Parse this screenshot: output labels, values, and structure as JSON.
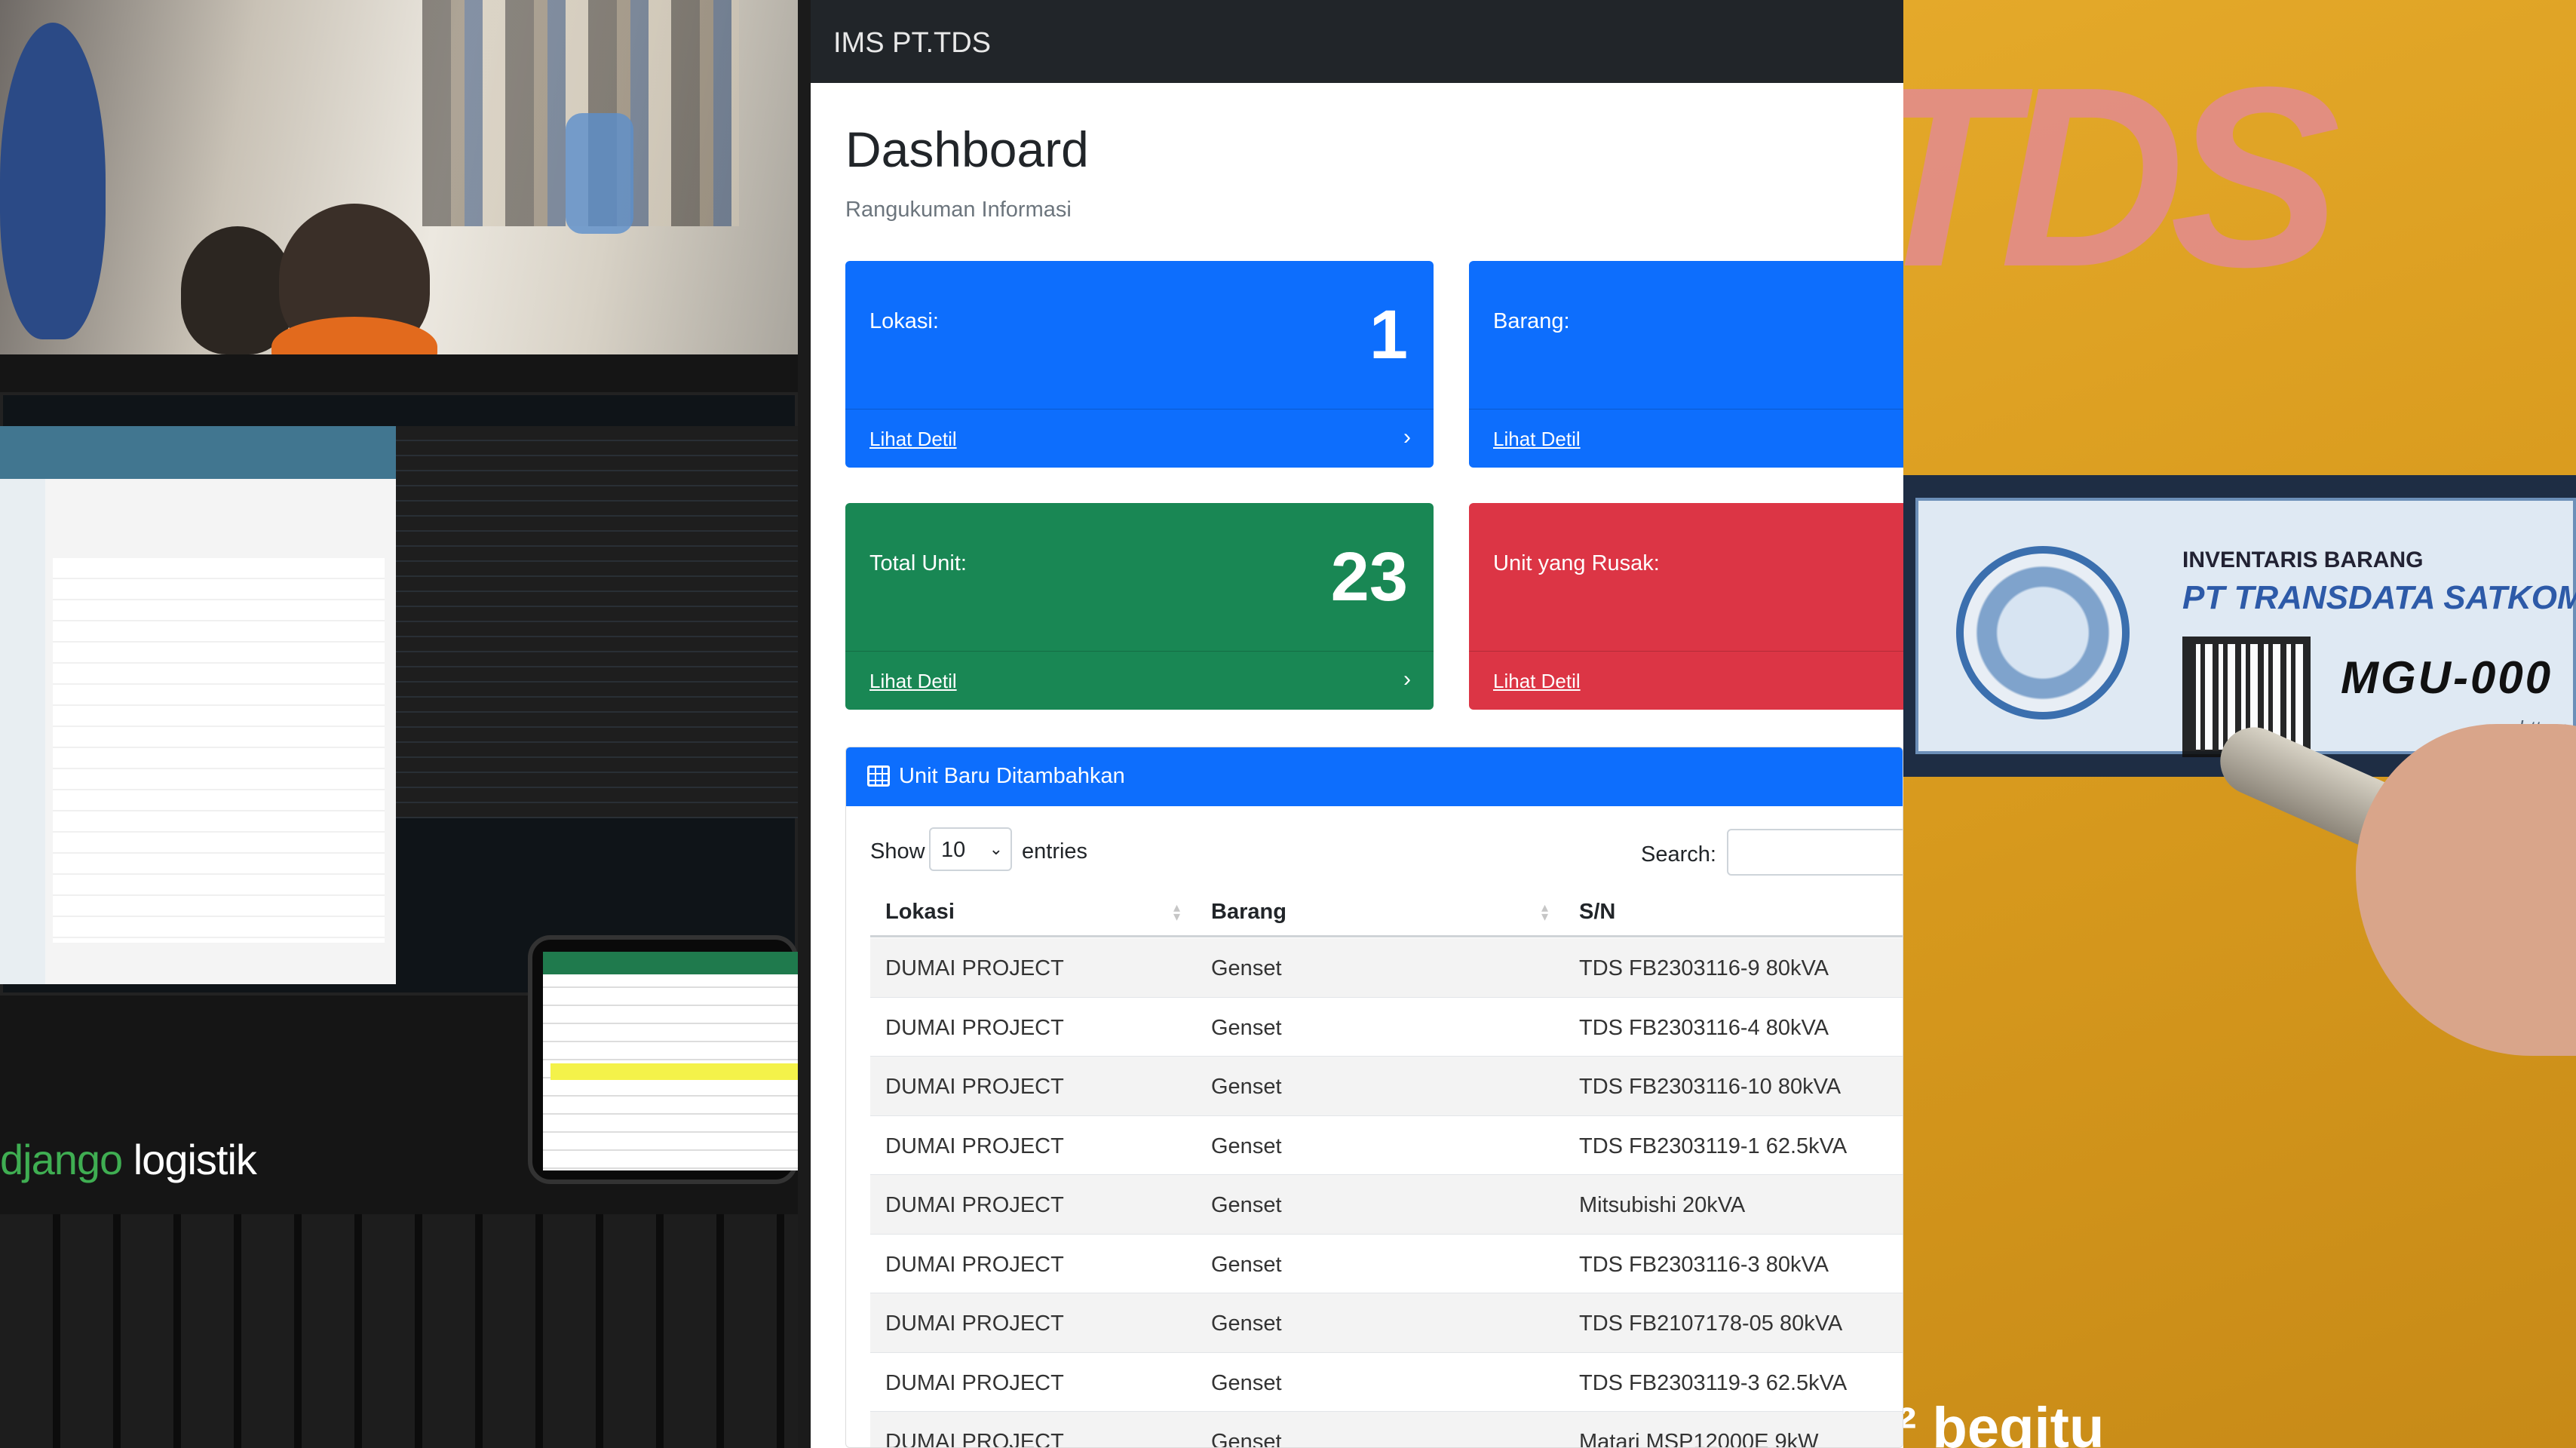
{
  "laptop_caption": {
    "part1": "django",
    "part2": "logistik"
  },
  "dashboard": {
    "brand": "IMS PT.TDS",
    "title": "Dashboard",
    "subtitle": "Rangukuman Informasi",
    "cards": {
      "lokasi": {
        "label": "Lokasi:",
        "value": "1",
        "link": "Lihat Detil"
      },
      "barang": {
        "label": "Barang:",
        "value": "",
        "link": "Lihat Detil"
      },
      "total_unit": {
        "label": "Total Unit:",
        "value": "23",
        "link": "Lihat Detil"
      },
      "unit_rusak": {
        "label": "Unit yang Rusak:",
        "value": "",
        "link": "Lihat Detil"
      }
    },
    "table": {
      "heading": "Unit Baru Ditambahkan",
      "show_label": "Show",
      "page_size": "10",
      "entries_label": "entries",
      "search_label": "Search:",
      "columns": [
        "Lokasi",
        "Barang",
        "S/N"
      ],
      "rows": [
        [
          "DUMAI PROJECT",
          "Genset",
          "TDS FB2303116-9 80kVA"
        ],
        [
          "DUMAI PROJECT",
          "Genset",
          "TDS FB2303116-4 80kVA"
        ],
        [
          "DUMAI PROJECT",
          "Genset",
          "TDS FB2303116-10 80kVA"
        ],
        [
          "DUMAI PROJECT",
          "Genset",
          "TDS FB2303119-1 62.5kVA"
        ],
        [
          "DUMAI PROJECT",
          "Genset",
          "Mitsubishi 20kVA"
        ],
        [
          "DUMAI PROJECT",
          "Genset",
          "TDS FB2303116-3 80kVA"
        ],
        [
          "DUMAI PROJECT",
          "Genset",
          "TDS FB2107178-05 80kVA"
        ],
        [
          "DUMAI PROJECT",
          "Genset",
          "TDS FB2303119-3 62.5kVA"
        ],
        [
          "DUMAI PROJECT",
          "Genset",
          "Matari MSP12000E 9kW"
        ]
      ]
    }
  },
  "sticker": {
    "line1": "INVENTARIS BARANG",
    "line2": "PT TRANSDATA SATKOM",
    "code": "MGU-000",
    "url": "https:"
  },
  "subtitle_text": "² begitu",
  "colors": {
    "primary": "#0d6efd",
    "success": "#198754",
    "danger": "#dc3545",
    "navbar": "#212529"
  }
}
